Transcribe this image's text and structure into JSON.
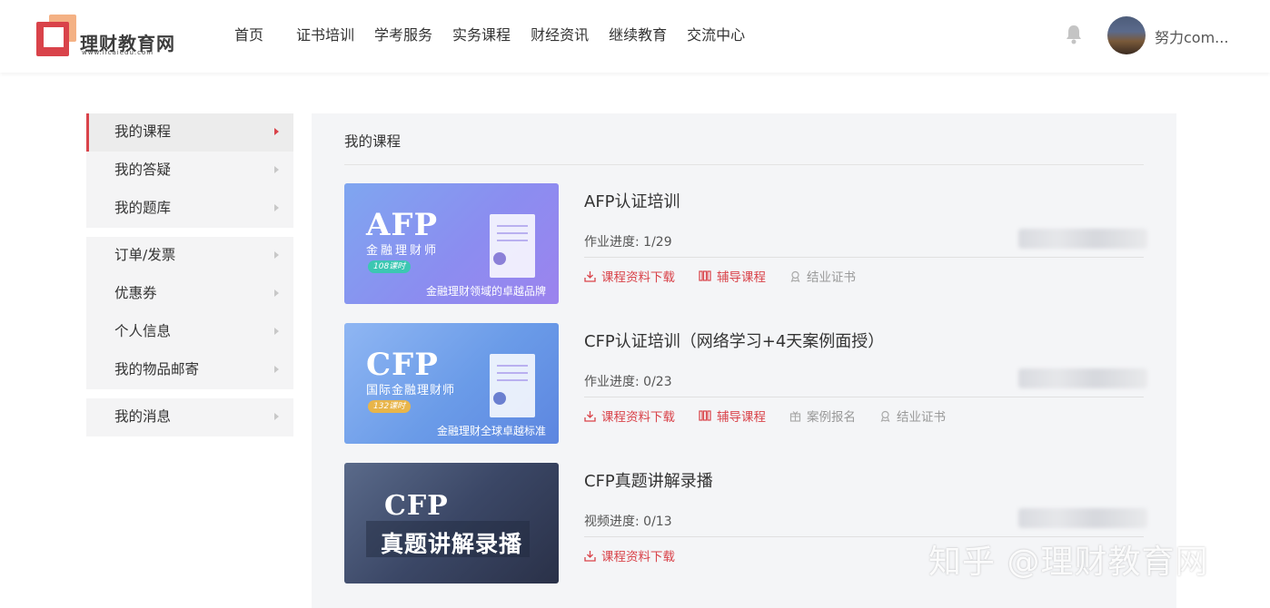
{
  "header": {
    "logo_text": "理财教育网",
    "logo_sub": "www.licaiedu.com",
    "nav": [
      "首页",
      "证书培训",
      "学考服务",
      "实务课程",
      "财经资讯",
      "继续教育",
      "交流中心"
    ],
    "username": "努力com..."
  },
  "sidebar": {
    "group1": [
      "我的课程",
      "我的答疑",
      "我的题库"
    ],
    "group2": [
      "订单/发票",
      "优惠券",
      "个人信息",
      "我的物品邮寄"
    ],
    "group3": [
      "我的消息"
    ]
  },
  "main": {
    "title": "我的课程",
    "courses": [
      {
        "cover_big": "AFP",
        "cover_sub": "金融理财师",
        "cover_tag": "108课时",
        "cover_slogan": "金融理财领域的卓越品牌",
        "title": "AFP认证培训",
        "progress": "作业进度: 1/29",
        "actions": [
          "课程资料下载",
          "辅导课程",
          "结业证书"
        ]
      },
      {
        "cover_big": "CFP",
        "cover_sub": "国际金融理财师",
        "cover_tag": "132课时",
        "cover_slogan": "金融理财全球卓越标准",
        "title": "CFP认证培训（网络学习+4天案例面授）",
        "progress": "作业进度: 0/23",
        "actions": [
          "课程资料下载",
          "辅导课程",
          "案例报名",
          "结业证书"
        ]
      },
      {
        "cover_big": "CFP",
        "cover_sub": "真题讲解录播",
        "title": "CFP真题讲解录播",
        "progress": "视频进度: 0/13",
        "actions": [
          "课程资料下载"
        ]
      }
    ]
  },
  "watermark": "知乎 @理财教育网",
  "colors": {
    "accent": "#d9434a",
    "grey_text": "#999999",
    "main_bg": "#f4f5f7"
  }
}
